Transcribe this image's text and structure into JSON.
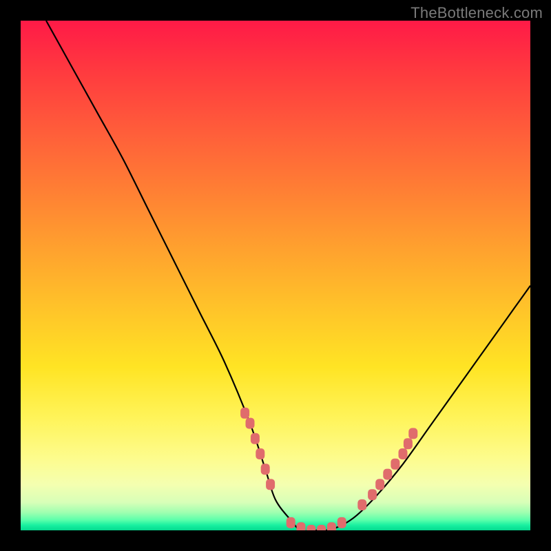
{
  "attribution": "TheBottleneck.com",
  "chart_data": {
    "type": "line",
    "title": "",
    "xlabel": "",
    "ylabel": "",
    "xlim": [
      0,
      100
    ],
    "ylim": [
      0,
      100
    ],
    "grid": false,
    "legend": false,
    "series": [
      {
        "name": "bottleneck-curve",
        "color": "#000000",
        "x": [
          5,
          10,
          15,
          20,
          25,
          30,
          35,
          40,
          45,
          48,
          50,
          53,
          55,
          58,
          60,
          63,
          66,
          70,
          75,
          80,
          85,
          90,
          95,
          100
        ],
        "y": [
          100,
          91,
          82,
          73,
          63,
          53,
          43,
          33,
          21,
          12,
          6,
          2,
          0,
          0,
          0,
          1,
          3,
          7,
          13,
          20,
          27,
          34,
          41,
          48
        ]
      }
    ],
    "markers": {
      "name": "highlight-dots",
      "color": "#e06c6c",
      "shape": "rounded-rect",
      "points": [
        {
          "x": 44,
          "y": 23
        },
        {
          "x": 45,
          "y": 21
        },
        {
          "x": 46,
          "y": 18
        },
        {
          "x": 47,
          "y": 15
        },
        {
          "x": 48,
          "y": 12
        },
        {
          "x": 49,
          "y": 9
        },
        {
          "x": 53,
          "y": 1.5
        },
        {
          "x": 55,
          "y": 0.5
        },
        {
          "x": 57,
          "y": 0
        },
        {
          "x": 59,
          "y": 0
        },
        {
          "x": 61,
          "y": 0.5
        },
        {
          "x": 63,
          "y": 1.5
        },
        {
          "x": 67,
          "y": 5
        },
        {
          "x": 69,
          "y": 7
        },
        {
          "x": 70.5,
          "y": 9
        },
        {
          "x": 72,
          "y": 11
        },
        {
          "x": 73.5,
          "y": 13
        },
        {
          "x": 75,
          "y": 15
        },
        {
          "x": 76,
          "y": 17
        },
        {
          "x": 77,
          "y": 19
        }
      ]
    },
    "gradient_stops": [
      {
        "pos": 0,
        "color": "#ff1a47"
      },
      {
        "pos": 0.45,
        "color": "#ffa22e"
      },
      {
        "pos": 0.78,
        "color": "#fff45a"
      },
      {
        "pos": 0.95,
        "color": "#d8ffb8"
      },
      {
        "pos": 1.0,
        "color": "#04d98f"
      }
    ]
  }
}
